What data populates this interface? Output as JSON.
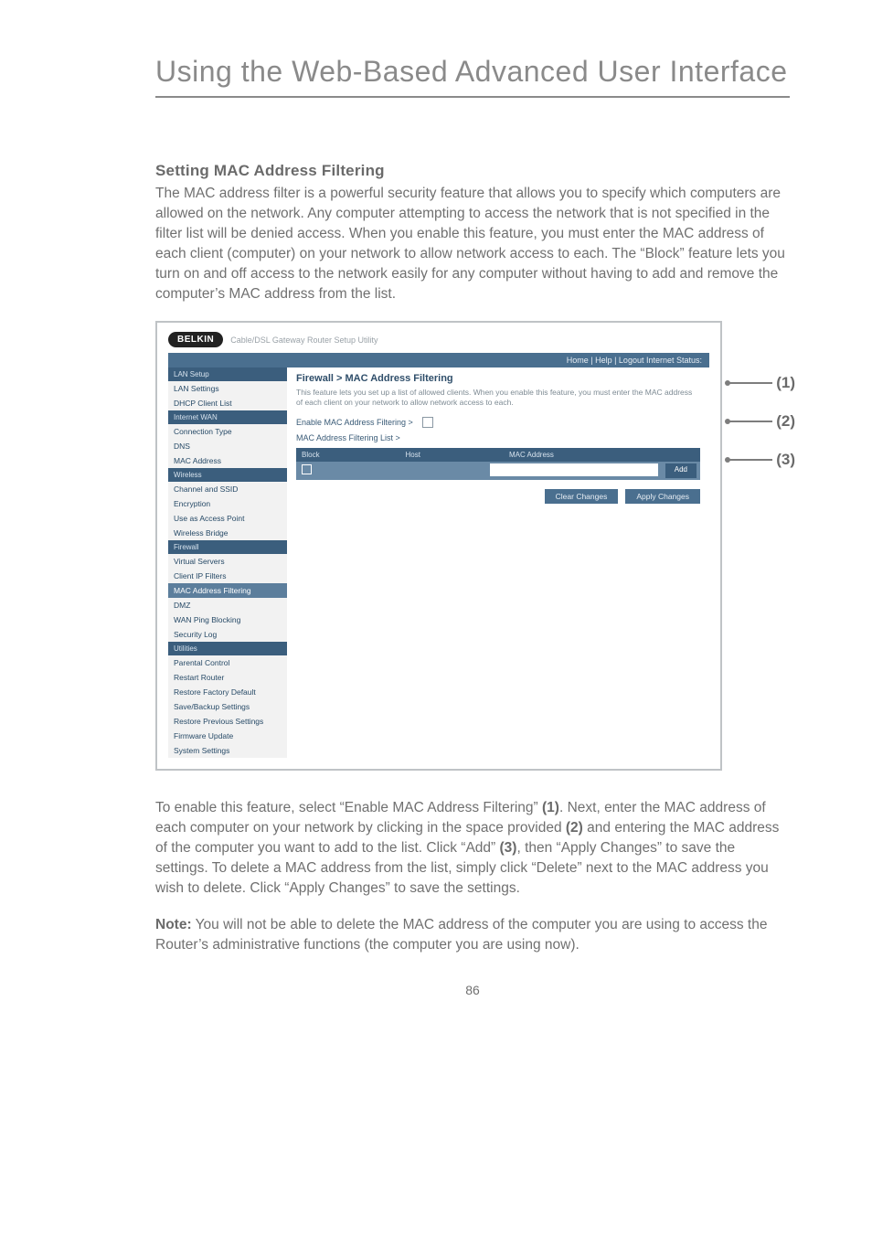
{
  "chapter_title": "Using the Web-Based Advanced User Interface",
  "section_heading": "Setting MAC Address Filtering",
  "intro_paragraph": "The MAC address filter is a powerful security feature that allows you to specify which computers are allowed on the network. Any computer attempting to access the network that is not specified in the filter list will be denied access. When you enable this feature, you must enter the MAC address of each client (computer) on your network to allow network access to each. The “Block” feature lets you turn on and off access to the network easily for any computer without having to add and remove the computer’s MAC address from the list.",
  "howto_paragraph_parts": [
    "To enable this feature, select “Enable MAC Address Filtering” ",
    "(1)",
    ". Next, enter the MAC address of each computer on your network by clicking in the space provided ",
    "(2)",
    " and entering the MAC address of the computer you want to add to the list. Click “Add” ",
    "(3)",
    ", then “Apply Changes” to save the settings. To delete a MAC address from the list, simply click “Delete” next to the MAC address you wish to delete. Click “Apply Changes” to save the settings."
  ],
  "note_label": "Note:",
  "note_text": " You will not be able to delete the MAC address of the computer you are using to access the Router’s administrative functions (the computer you are using now).",
  "page_number": "86",
  "callouts": {
    "c1": "(1)",
    "c2": "(2)",
    "c3": "(3)"
  },
  "shot": {
    "brand": "BELKIN",
    "brand_sub": "Cable/DSL Gateway Router Setup Utility",
    "topbar": "Home | Help | Logout   Internet Status:",
    "panel_title": "Firewall > MAC Address Filtering",
    "panel_desc": "This feature lets you set up a list of allowed clients. When you enable this feature, you must enter the MAC address of each client on your network to allow network access to each. ",
    "enable_label": "Enable MAC Address Filtering >",
    "list_label": "MAC Address Filtering List >",
    "th_block": "Block",
    "th_host": "Host",
    "th_mac": "MAC Address",
    "add_btn": "Add",
    "clear_btn": "Clear Changes",
    "apply_btn": "Apply Changes",
    "sidebar": {
      "groups": [
        {
          "head": "LAN Setup",
          "items": [
            "LAN Settings",
            "DHCP Client List"
          ]
        },
        {
          "head": "Internet WAN",
          "items": [
            "Connection Type",
            "DNS",
            "MAC Address"
          ]
        },
        {
          "head": "Wireless",
          "items": [
            "Channel and SSID",
            "Encryption",
            "Use as Access Point",
            "Wireless Bridge"
          ]
        },
        {
          "head": "Firewall",
          "items": [
            "Virtual Servers",
            "Client IP Filters",
            "MAC Address Filtering",
            "DMZ",
            "WAN Ping Blocking",
            "Security Log"
          ]
        },
        {
          "head": "Utilities",
          "items": [
            "Parental Control",
            "Restart Router",
            "Restore Factory Default",
            "Save/Backup Settings",
            "Restore Previous Settings",
            "Firmware Update",
            "System Settings"
          ]
        }
      ],
      "selected": "MAC Address Filtering"
    }
  }
}
